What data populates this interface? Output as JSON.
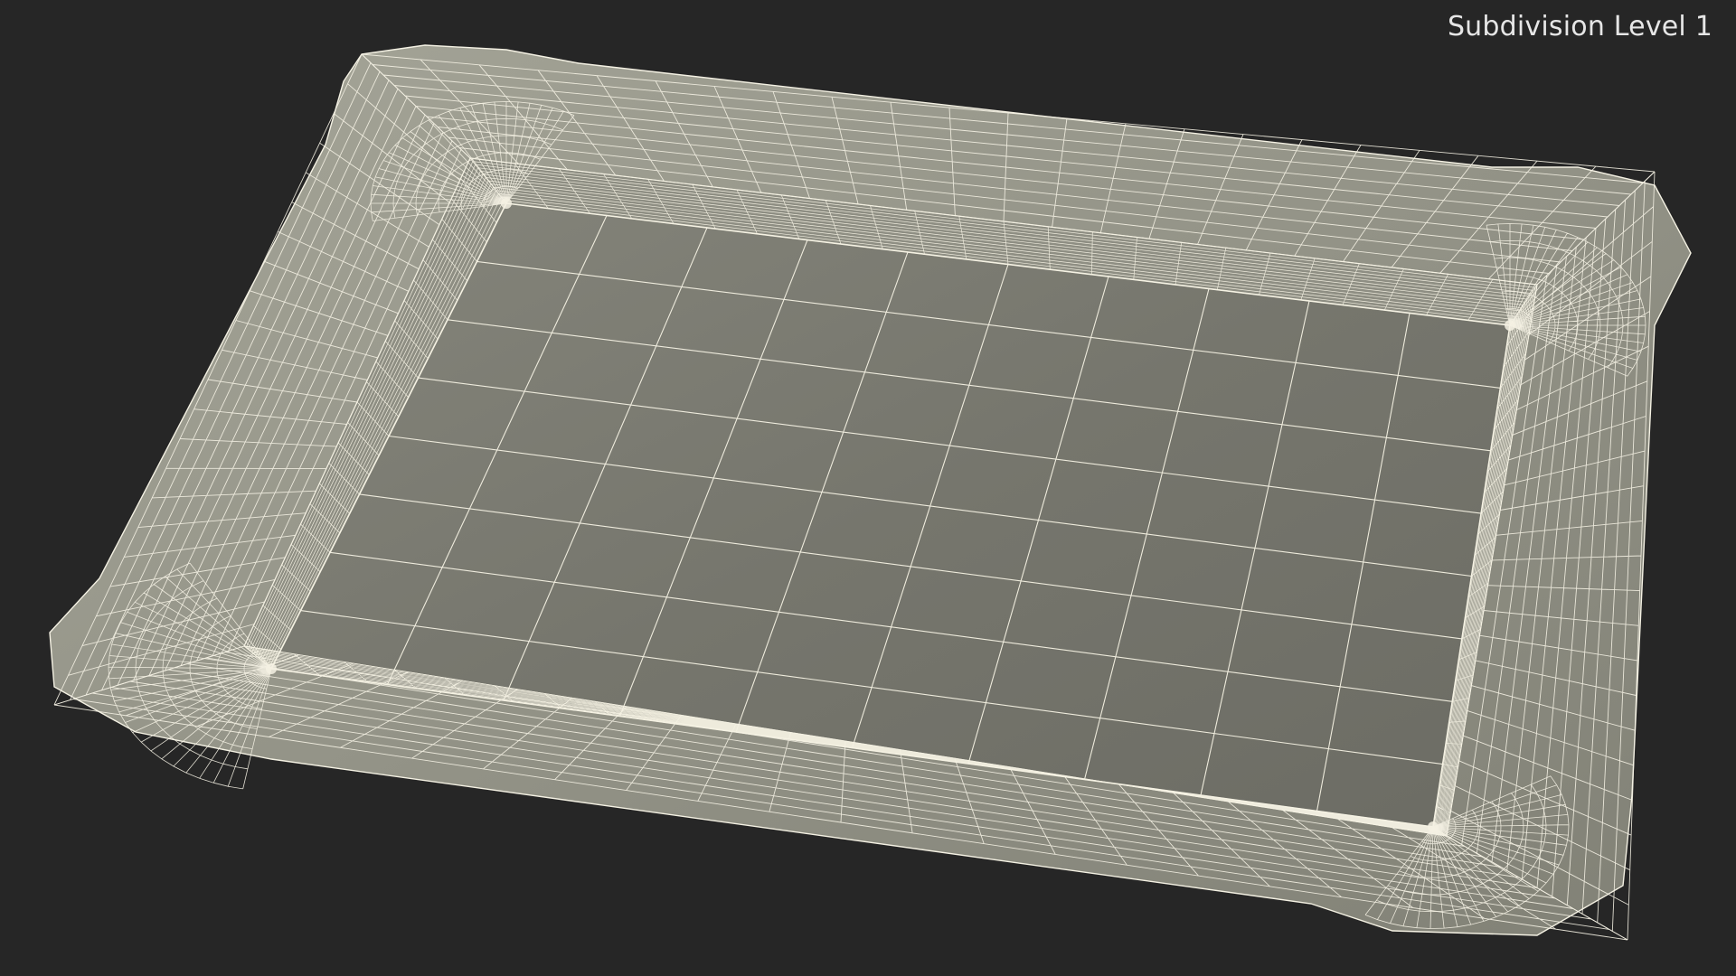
{
  "viewport": {
    "label": "Subdivision Level 1",
    "background_color": "#262626"
  },
  "model": {
    "name_icon": "paper-tray-wireframe",
    "surface_color": "#76766d",
    "surface_rim_color": "#8a8a80",
    "wire_color": "#f4f1e3"
  }
}
